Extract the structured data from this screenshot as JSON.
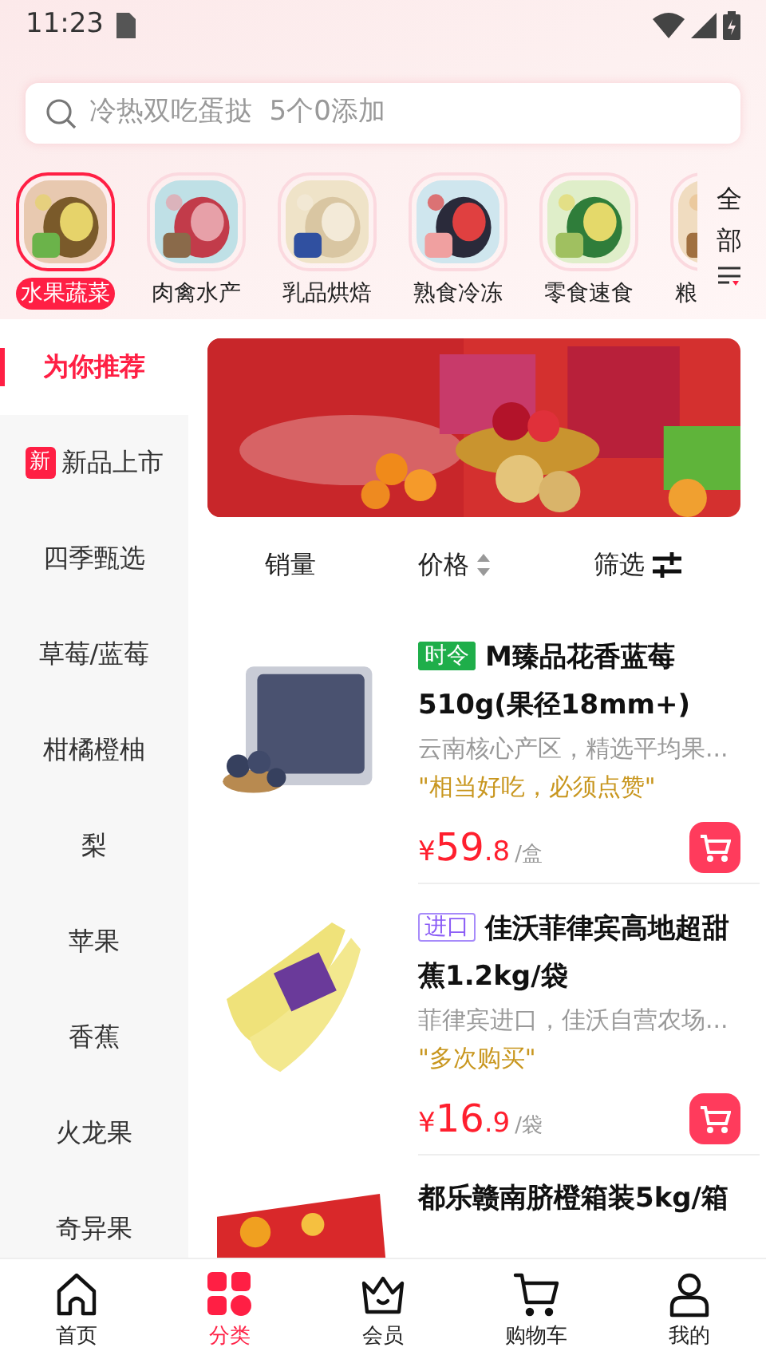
{
  "status_bar": {
    "time": "11:23"
  },
  "search": {
    "placeholder": "冷热双吃蛋挞  5个0添加"
  },
  "categories": [
    {
      "label": "水果蔬菜",
      "selected": true,
      "kind": "picture"
    },
    {
      "label": "肉禽水产",
      "selected": false,
      "kind": "picture"
    },
    {
      "label": "乳品烘焙",
      "selected": false,
      "kind": "picture"
    },
    {
      "label": "熟食冷冻",
      "selected": false,
      "kind": "picture"
    },
    {
      "label": "零食速食",
      "selected": false,
      "kind": "picture"
    },
    {
      "label": "粮",
      "selected": false,
      "kind": "picture"
    }
  ],
  "all_button": {
    "label": "全部"
  },
  "sidebar": {
    "items": [
      {
        "label": "为你推荐",
        "selected": true
      },
      {
        "label": "新品上市",
        "selected": false,
        "badge": "新"
      },
      {
        "label": "四季甄选",
        "selected": false
      },
      {
        "label": "草莓/蓝莓",
        "selected": false
      },
      {
        "label": "柑橘橙柚",
        "selected": false
      },
      {
        "label": "梨",
        "selected": false
      },
      {
        "label": "苹果",
        "selected": false
      },
      {
        "label": "香蕉",
        "selected": false
      },
      {
        "label": "火龙果",
        "selected": false
      },
      {
        "label": "奇异果",
        "selected": false
      }
    ]
  },
  "sort_bar": [
    {
      "label": "销量",
      "kind": "plain"
    },
    {
      "label": "价格",
      "kind": "sort"
    },
    {
      "label": "筛选",
      "kind": "filter"
    }
  ],
  "products": [
    {
      "tag": {
        "text": "时令",
        "kind": "seasonal"
      },
      "title": "M臻品花香蓝莓510g(果径18mm+)",
      "subtitle": "云南核心产区，精选平均果...",
      "quote": "\"相当好吃，必须点赞\"",
      "currency": "¥",
      "price_main": "59",
      "price_decimal": ".8",
      "unit": "/盒",
      "kind": "blueberry"
    },
    {
      "tag": {
        "text": "进口",
        "kind": "import"
      },
      "title": "佳沃菲律宾高地超甜蕉1.2kg/袋",
      "subtitle": "菲律宾进口，佳沃自营农场...",
      "quote": "\"多次购买\"",
      "currency": "¥",
      "price_main": "16",
      "price_decimal": ".9",
      "unit": "/袋",
      "kind": "banana"
    },
    {
      "title": "都乐赣南脐橙箱装5kg/箱",
      "kind": "box"
    }
  ],
  "bottom_nav": [
    {
      "label": "首页",
      "kind": "home",
      "selected": false
    },
    {
      "label": "分类",
      "kind": "grid",
      "selected": true
    },
    {
      "label": "会员",
      "kind": "crown",
      "selected": false
    },
    {
      "label": "购物车",
      "kind": "cart",
      "selected": false
    },
    {
      "label": "我的",
      "kind": "user",
      "selected": false
    }
  ]
}
